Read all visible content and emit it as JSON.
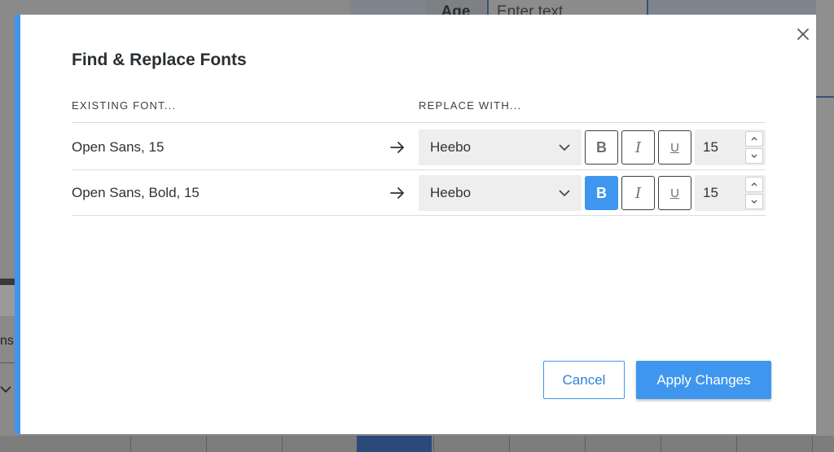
{
  "background": {
    "header_cell_label": "Age",
    "header_input_placeholder": "Enter text",
    "left_fragment_text": "ns"
  },
  "dialog": {
    "title": "Find & Replace Fonts",
    "close_icon": "close-icon",
    "columns": {
      "existing": "EXISTING FONT...",
      "replace": "REPLACE WITH..."
    },
    "rows": [
      {
        "existing_font": "Open Sans, 15",
        "replacement_font": "Heebo",
        "bold_label": "B",
        "bold_active": false,
        "italic_label": "I",
        "underline_label": "U",
        "size": "15"
      },
      {
        "existing_font": "Open Sans, Bold, 15",
        "replacement_font": "Heebo",
        "bold_label": "B",
        "bold_active": true,
        "italic_label": "I",
        "underline_label": "U",
        "size": "15"
      }
    ],
    "cancel_label": "Cancel",
    "apply_label": "Apply Changes"
  },
  "colors": {
    "accent": "#3f96ee",
    "text": "#2e3236",
    "select_bg": "#eeeeee",
    "divider": "#dcdcdc"
  }
}
